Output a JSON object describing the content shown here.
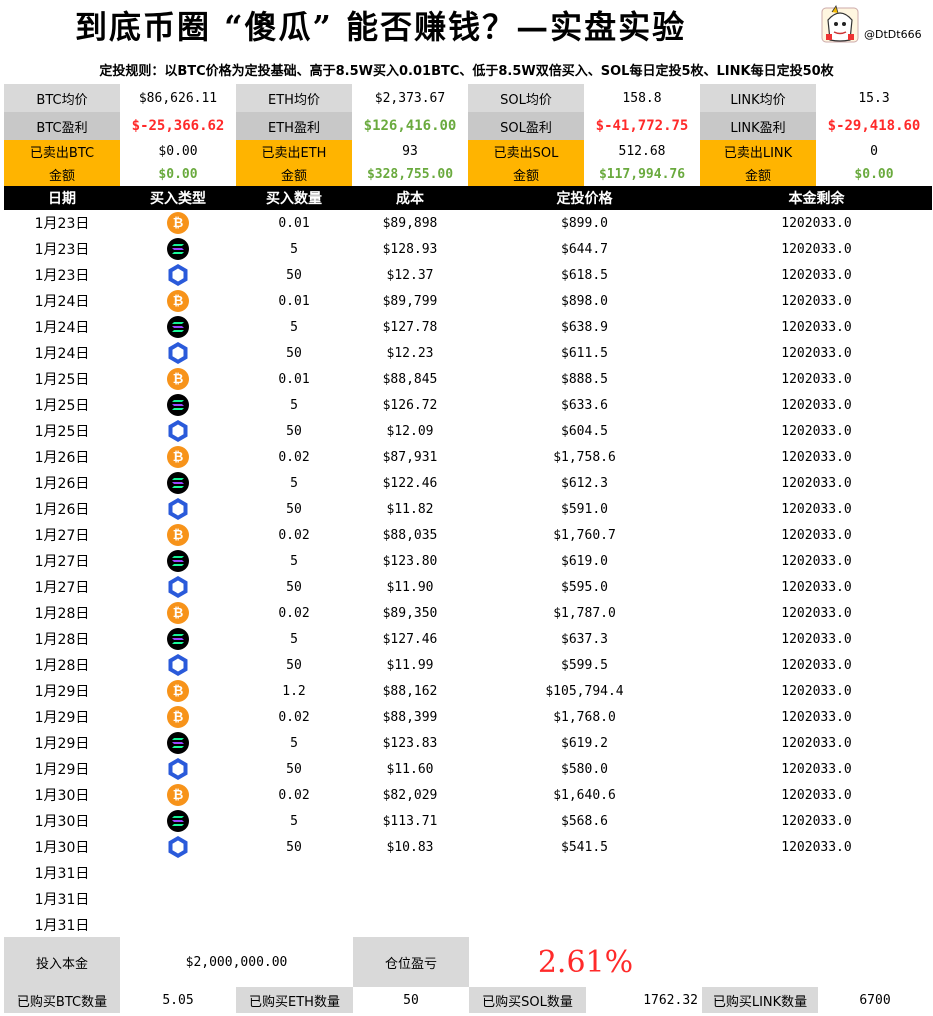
{
  "title": "到底币圈 “傻瓜” 能否赚钱？—实盘实验",
  "handle": "@DtDt666",
  "rules": "定投规则：以BTC价格为定投基础、高于8.5W买入0.01BTC、低于8.5W双倍买入、SOL每日定投5枚、LINK每日定投50枚",
  "summary": {
    "avg": [
      {
        "label": "BTC均价",
        "value": "$86,626.11"
      },
      {
        "label": "ETH均价",
        "value": "$2,373.67"
      },
      {
        "label": "SOL均价",
        "value": "158.8"
      },
      {
        "label": "LINK均价",
        "value": "15.3"
      }
    ],
    "profit": [
      {
        "label": "BTC盈利",
        "value": "$-25,366.62",
        "sign": "neg"
      },
      {
        "label": "ETH盈利",
        "value": "$126,416.00",
        "sign": "pos"
      },
      {
        "label": "SOL盈利",
        "value": "$-41,772.75",
        "sign": "neg"
      },
      {
        "label": "LINK盈利",
        "value": "$-29,418.60",
        "sign": "neg"
      }
    ],
    "sold": [
      {
        "label1": "已卖出BTC",
        "label2": "金额",
        "qty": "$0.00",
        "amount": "$0.00"
      },
      {
        "label1": "已卖出ETH",
        "label2": "金额",
        "qty": "93",
        "amount": "$328,755.00"
      },
      {
        "label1": "已卖出SOL",
        "label2": "金额",
        "qty": "512.68",
        "amount": "$117,994.76"
      },
      {
        "label1": "已卖出LINK",
        "label2": "金额",
        "qty": "0",
        "amount": "$0.00"
      }
    ]
  },
  "table": {
    "headers": [
      "日期",
      "买入类型",
      "买入数量",
      "成本",
      "定投价格",
      "本金剩余"
    ],
    "rows": [
      {
        "date": "1月23日",
        "coin": "btc",
        "qty": "0.01",
        "cost": "$89,898",
        "price": "$899.0",
        "remain": "1202033.0"
      },
      {
        "date": "1月23日",
        "coin": "sol",
        "qty": "5",
        "cost": "$128.93",
        "price": "$644.7",
        "remain": "1202033.0"
      },
      {
        "date": "1月23日",
        "coin": "link",
        "qty": "50",
        "cost": "$12.37",
        "price": "$618.5",
        "remain": "1202033.0"
      },
      {
        "date": "1月24日",
        "coin": "btc",
        "qty": "0.01",
        "cost": "$89,799",
        "price": "$898.0",
        "remain": "1202033.0"
      },
      {
        "date": "1月24日",
        "coin": "sol",
        "qty": "5",
        "cost": "$127.78",
        "price": "$638.9",
        "remain": "1202033.0"
      },
      {
        "date": "1月24日",
        "coin": "link",
        "qty": "50",
        "cost": "$12.23",
        "price": "$611.5",
        "remain": "1202033.0"
      },
      {
        "date": "1月25日",
        "coin": "btc",
        "qty": "0.01",
        "cost": "$88,845",
        "price": "$888.5",
        "remain": "1202033.0"
      },
      {
        "date": "1月25日",
        "coin": "sol",
        "qty": "5",
        "cost": "$126.72",
        "price": "$633.6",
        "remain": "1202033.0"
      },
      {
        "date": "1月25日",
        "coin": "link",
        "qty": "50",
        "cost": "$12.09",
        "price": "$604.5",
        "remain": "1202033.0"
      },
      {
        "date": "1月26日",
        "coin": "btc",
        "qty": "0.02",
        "cost": "$87,931",
        "price": "$1,758.6",
        "remain": "1202033.0"
      },
      {
        "date": "1月26日",
        "coin": "sol",
        "qty": "5",
        "cost": "$122.46",
        "price": "$612.3",
        "remain": "1202033.0"
      },
      {
        "date": "1月26日",
        "coin": "link",
        "qty": "50",
        "cost": "$11.82",
        "price": "$591.0",
        "remain": "1202033.0"
      },
      {
        "date": "1月27日",
        "coin": "btc",
        "qty": "0.02",
        "cost": "$88,035",
        "price": "$1,760.7",
        "remain": "1202033.0"
      },
      {
        "date": "1月27日",
        "coin": "sol",
        "qty": "5",
        "cost": "$123.80",
        "price": "$619.0",
        "remain": "1202033.0"
      },
      {
        "date": "1月27日",
        "coin": "link",
        "qty": "50",
        "cost": "$11.90",
        "price": "$595.0",
        "remain": "1202033.0"
      },
      {
        "date": "1月28日",
        "coin": "btc",
        "qty": "0.02",
        "cost": "$89,350",
        "price": "$1,787.0",
        "remain": "1202033.0"
      },
      {
        "date": "1月28日",
        "coin": "sol",
        "qty": "5",
        "cost": "$127.46",
        "price": "$637.3",
        "remain": "1202033.0"
      },
      {
        "date": "1月28日",
        "coin": "link",
        "qty": "50",
        "cost": "$11.99",
        "price": "$599.5",
        "remain": "1202033.0"
      },
      {
        "date": "1月29日",
        "coin": "btc",
        "qty": "1.2",
        "cost": "$88,162",
        "price": "$105,794.4",
        "remain": "1202033.0"
      },
      {
        "date": "1月29日",
        "coin": "btc",
        "qty": "0.02",
        "cost": "$88,399",
        "price": "$1,768.0",
        "remain": "1202033.0"
      },
      {
        "date": "1月29日",
        "coin": "sol",
        "qty": "5",
        "cost": "$123.83",
        "price": "$619.2",
        "remain": "1202033.0"
      },
      {
        "date": "1月29日",
        "coin": "link",
        "qty": "50",
        "cost": "$11.60",
        "price": "$580.0",
        "remain": "1202033.0"
      },
      {
        "date": "1月30日",
        "coin": "btc",
        "qty": "0.02",
        "cost": "$82,029",
        "price": "$1,640.6",
        "remain": "1202033.0"
      },
      {
        "date": "1月30日",
        "coin": "sol",
        "qty": "5",
        "cost": "$113.71",
        "price": "$568.6",
        "remain": "1202033.0"
      },
      {
        "date": "1月30日",
        "coin": "link",
        "qty": "50",
        "cost": "$10.83",
        "price": "$541.5",
        "remain": "1202033.0"
      },
      {
        "date": "1月31日",
        "coin": "",
        "qty": "",
        "cost": "",
        "price": "",
        "remain": ""
      },
      {
        "date": "1月31日",
        "coin": "",
        "qty": "",
        "cost": "",
        "price": "",
        "remain": ""
      },
      {
        "date": "1月31日",
        "coin": "",
        "qty": "",
        "cost": "",
        "price": "",
        "remain": ""
      }
    ]
  },
  "bottom": {
    "principal_label": "投入本金",
    "principal_value": "$2,000,000.00",
    "pnl_label": "仓位盈亏",
    "pnl_value": "2.61%",
    "holdings": [
      {
        "label": "已购买BTC数量",
        "value": "5.05"
      },
      {
        "label": "已购买ETH数量",
        "value": "50"
      },
      {
        "label": "已购买SOL数量",
        "value": "1762.32"
      },
      {
        "label": "已购买LINK数量",
        "value": "6700"
      }
    ]
  },
  "colors": {
    "negative": "#ff2a2a",
    "positive": "#6aaa3e",
    "gold": "#ffb400",
    "btc": "#f7931a",
    "link": "#2a5ada"
  }
}
